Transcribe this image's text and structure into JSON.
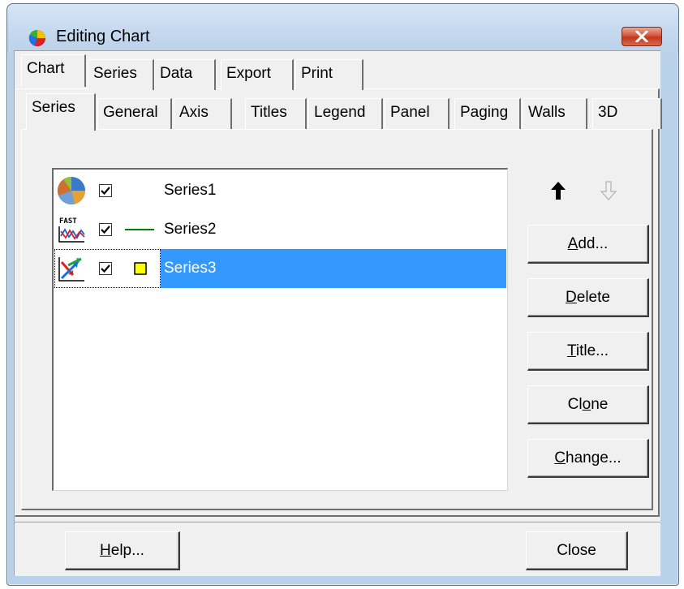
{
  "window": {
    "title": "Editing Chart",
    "close_icon": "close-icon"
  },
  "main_tabs": [
    {
      "label": "Chart",
      "active": true
    },
    {
      "label": "Series",
      "active": false
    },
    {
      "label": "Data",
      "active": false
    },
    {
      "label": "Export",
      "active": false
    },
    {
      "label": "Print",
      "active": false
    }
  ],
  "chart_tabs": [
    {
      "label": "Series",
      "active": true
    },
    {
      "label": "General",
      "active": false
    },
    {
      "label": "Axis",
      "active": false
    },
    {
      "label": "Titles",
      "active": false
    },
    {
      "label": "Legend",
      "active": false
    },
    {
      "label": "Panel",
      "active": false
    },
    {
      "label": "Paging",
      "active": false
    },
    {
      "label": "Walls",
      "active": false
    },
    {
      "label": "3D",
      "active": false
    }
  ],
  "series_list": [
    {
      "name": "Series1",
      "checked": true,
      "icon": "pie-chart-icon",
      "marker": "none",
      "selected": false
    },
    {
      "name": "Series2",
      "checked": true,
      "icon": "fast-line-icon",
      "marker": "line",
      "marker_color": "#008000",
      "selected": false
    },
    {
      "name": "Series3",
      "checked": true,
      "icon": "arrow-series-icon",
      "marker": "square",
      "marker_color": "#ffff00",
      "selected": true
    }
  ],
  "side_buttons": {
    "move_up_icon": "arrow-up-icon",
    "move_down_icon": "arrow-down-icon",
    "add_prefix": "",
    "add_mnemonic": "A",
    "add_suffix": "dd...",
    "delete_prefix": "",
    "delete_mnemonic": "D",
    "delete_suffix": "elete",
    "title_prefix": "",
    "title_mnemonic": "T",
    "title_suffix": "itle...",
    "clone_prefix": "Cl",
    "clone_mnemonic": "o",
    "clone_suffix": "ne",
    "change_prefix": "",
    "change_mnemonic": "C",
    "change_suffix": "hange..."
  },
  "footer": {
    "help_prefix": "",
    "help_mnemonic": "H",
    "help_suffix": "elp...",
    "close_label": "Close"
  },
  "colors": {
    "selection": "#3399ff",
    "frame": "#b9d1ea",
    "face": "#f0f0f0"
  }
}
